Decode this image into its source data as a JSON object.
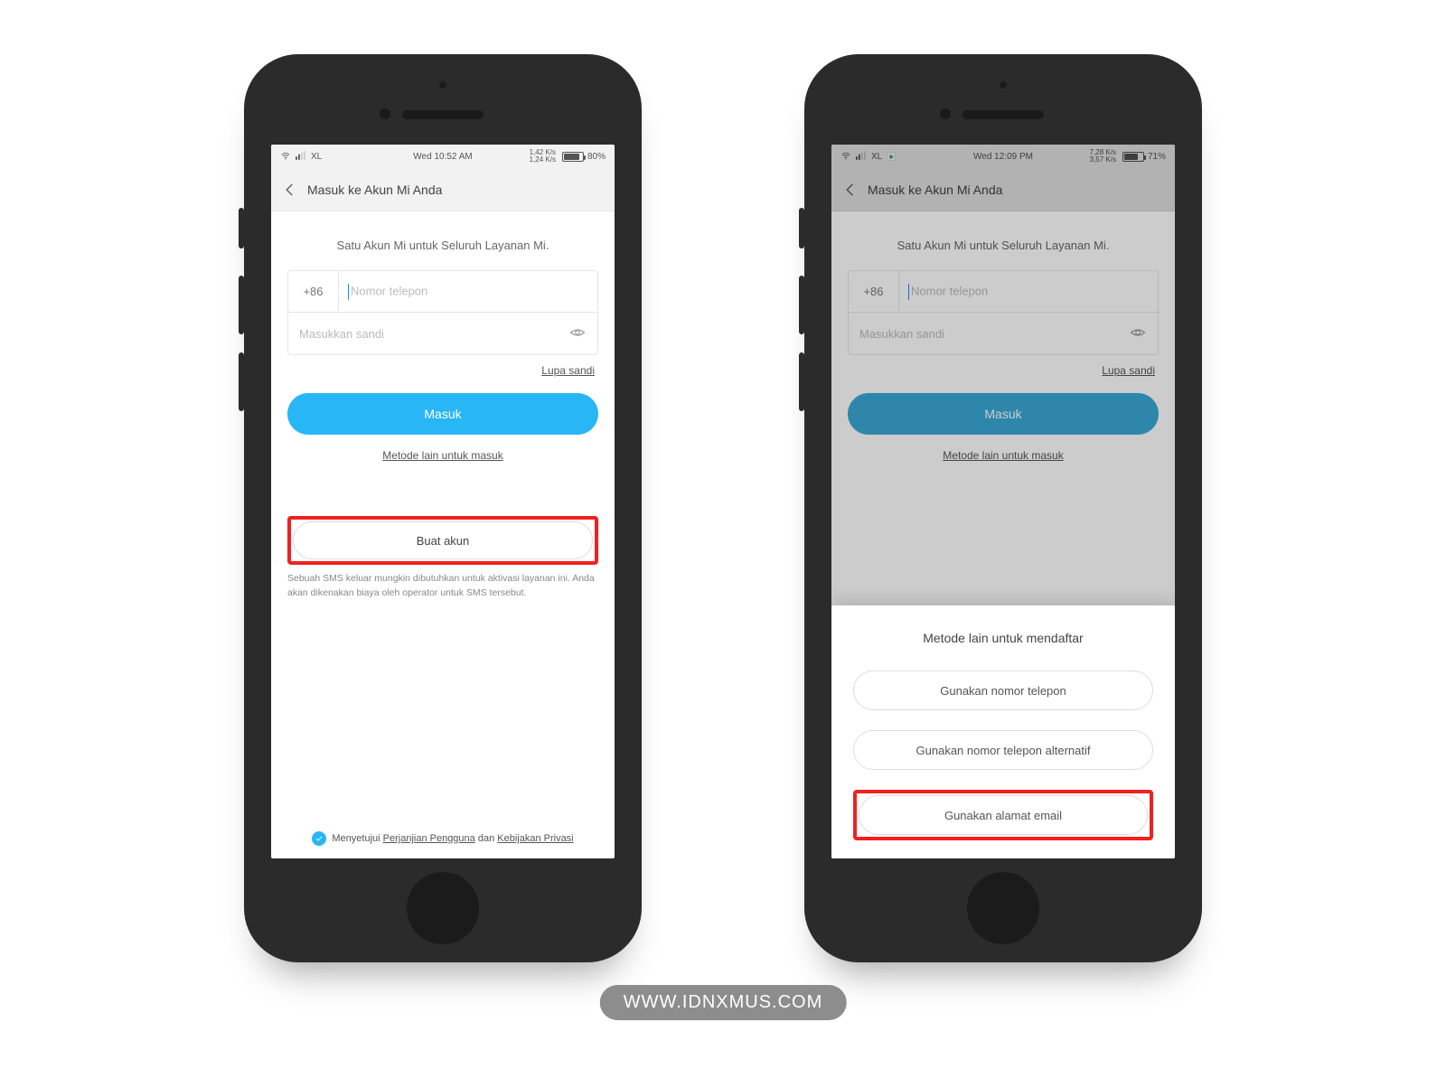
{
  "watermark": "WWW.IDNXMUS.COM",
  "left": {
    "status": {
      "carrier": "XL",
      "time": "Wed 10:52 AM",
      "net_up": "1,42 K/s",
      "net_dn": "1,24 K/s",
      "battery": "80%"
    },
    "header_title": "Masuk ke Akun Mi Anda",
    "tagline": "Satu Akun Mi untuk Seluruh Layanan Mi.",
    "country_code": "+86",
    "phone_placeholder": "Nomor telepon",
    "password_placeholder": "Masukkan sandi",
    "forgot": "Lupa sandi",
    "signin_label": "Masuk",
    "alt_login": "Metode lain untuk masuk",
    "create_label": "Buat akun",
    "disclaimer": "Sebuah SMS keluar mungkin dibutuhkan untuk aktivasi layanan ini. Anda akan dikenakan biaya oleh operator untuk SMS tersebut.",
    "consent_pre": "Menyetujui ",
    "consent_ua": "Perjanjian Pengguna",
    "consent_mid": " dan ",
    "consent_pp": "Kebijakan Privasi"
  },
  "right": {
    "status": {
      "carrier": "XL",
      "time": "Wed 12:09 PM",
      "net_up": "7,28 K/s",
      "net_dn": "3,57 K/s",
      "battery": "71%"
    },
    "header_title": "Masuk ke Akun Mi Anda",
    "tagline": "Satu Akun Mi untuk Seluruh Layanan Mi.",
    "country_code": "+86",
    "phone_placeholder": "Nomor telepon",
    "password_placeholder": "Masukkan sandi",
    "forgot": "Lupa sandi",
    "signin_label": "Masuk",
    "alt_login": "Metode lain untuk masuk",
    "sheet_title": "Metode lain untuk mendaftar",
    "opt_phone": "Gunakan nomor telepon",
    "opt_phone_alt": "Gunakan nomor telepon alternatif",
    "opt_email": "Gunakan alamat email"
  }
}
